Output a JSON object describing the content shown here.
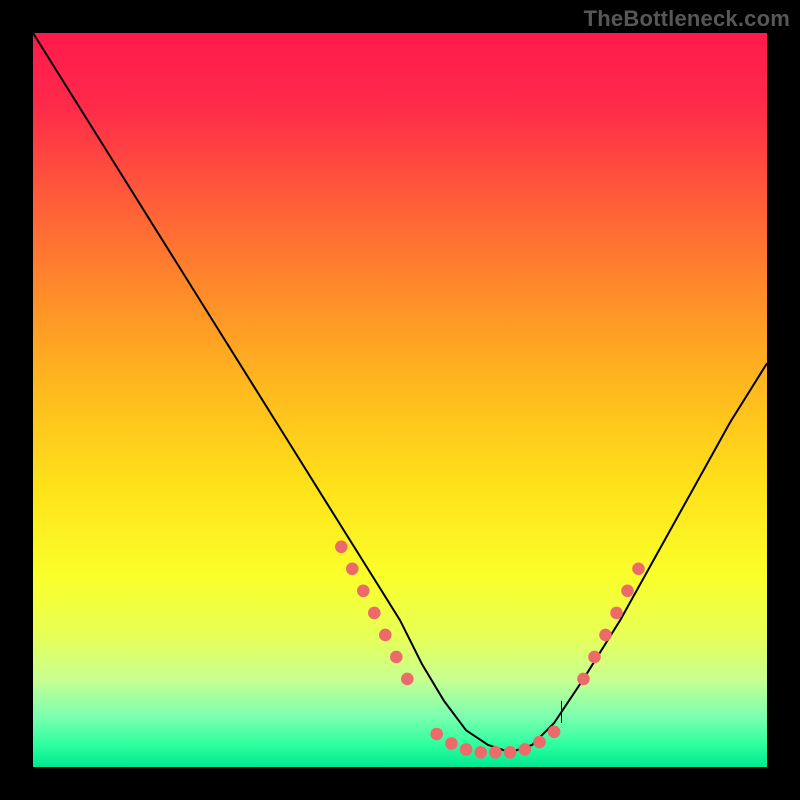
{
  "watermark": "TheBottleneck.com",
  "chart_data": {
    "type": "line",
    "title": "",
    "xlabel": "",
    "ylabel": "",
    "xlim": [
      0,
      100
    ],
    "ylim": [
      0,
      100
    ],
    "grid": false,
    "legend": false,
    "series": [
      {
        "name": "curve",
        "x": [
          0,
          5,
          10,
          15,
          20,
          25,
          30,
          35,
          40,
          45,
          50,
          53,
          56,
          59,
          62,
          65,
          68,
          71,
          75,
          80,
          85,
          90,
          95,
          100
        ],
        "y": [
          100,
          92,
          84,
          76,
          68,
          60,
          52,
          44,
          36,
          28,
          20,
          14,
          9,
          5,
          3,
          2,
          3,
          6,
          12,
          20,
          29,
          38,
          47,
          55
        ]
      }
    ],
    "dots_left": [
      {
        "x": 42,
        "y": 30
      },
      {
        "x": 43.5,
        "y": 27
      },
      {
        "x": 45,
        "y": 24
      },
      {
        "x": 46.5,
        "y": 21
      },
      {
        "x": 48,
        "y": 18
      },
      {
        "x": 49.5,
        "y": 15
      },
      {
        "x": 51,
        "y": 12
      }
    ],
    "dots_bottom": [
      {
        "x": 55,
        "y": 4.5
      },
      {
        "x": 57,
        "y": 3.2
      },
      {
        "x": 59,
        "y": 2.4
      },
      {
        "x": 61,
        "y": 2.0
      },
      {
        "x": 63,
        "y": 2.0
      },
      {
        "x": 65,
        "y": 2.0
      },
      {
        "x": 67,
        "y": 2.4
      },
      {
        "x": 69,
        "y": 3.4
      },
      {
        "x": 71,
        "y": 4.8
      }
    ],
    "dots_right": [
      {
        "x": 75,
        "y": 12
      },
      {
        "x": 76.5,
        "y": 15
      },
      {
        "x": 78,
        "y": 18
      },
      {
        "x": 79.5,
        "y": 21
      },
      {
        "x": 81,
        "y": 24
      },
      {
        "x": 82.5,
        "y": 27
      }
    ],
    "tick_at_x": 72
  }
}
